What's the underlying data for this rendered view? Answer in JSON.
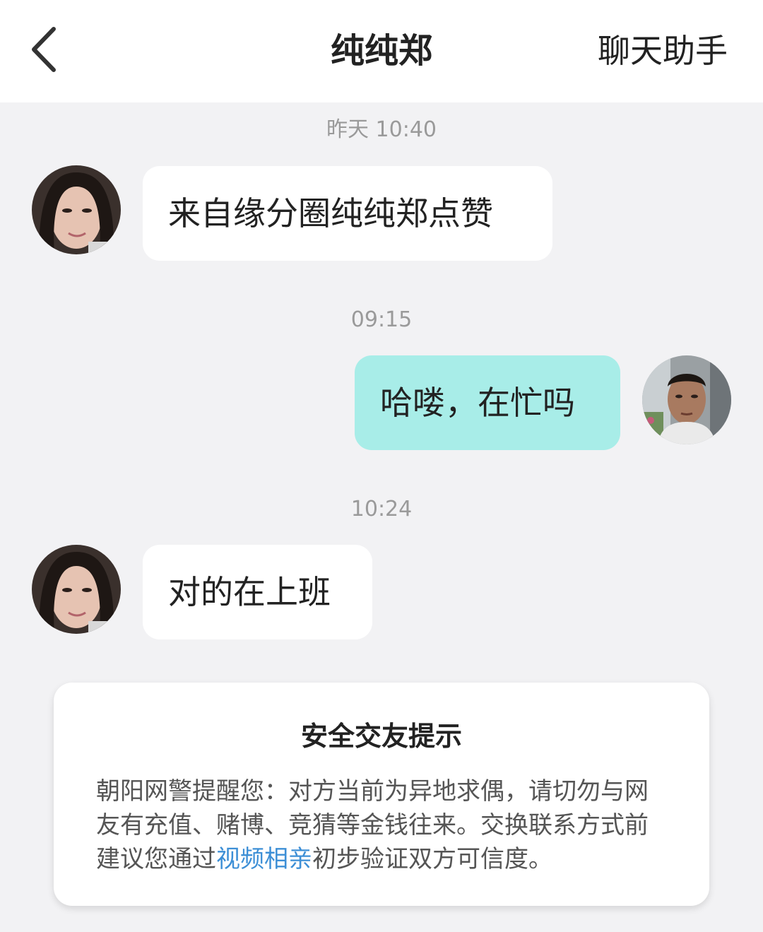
{
  "header": {
    "back_icon": "chevron-left-icon",
    "title": "纯纯郑",
    "assistant_label": "聊天助手"
  },
  "messages": [
    {
      "time": "昨天 10:40",
      "sender": "them",
      "text": "来自缘分圈纯纯郑点赞"
    },
    {
      "time": "09:15",
      "sender": "me",
      "text": "哈喽，在忙吗"
    },
    {
      "time": "10:24",
      "sender": "them",
      "text": "对的在上班"
    }
  ],
  "safety_card": {
    "title": "安全交友提示",
    "text_before": "朝阳网警提醒您：对方当前为异地求偶，请切勿与网友有充值、赌博、竞猜等金钱往来。交换联系方式前建议您通过",
    "link": "视频相亲",
    "text_after": "初步验证双方可信度。"
  },
  "colors": {
    "background": "#f2f2f4",
    "bubble_incoming": "#ffffff",
    "bubble_outgoing": "#a8ede8",
    "link": "#3d8fd6",
    "timestamp": "#9a9a9a"
  }
}
